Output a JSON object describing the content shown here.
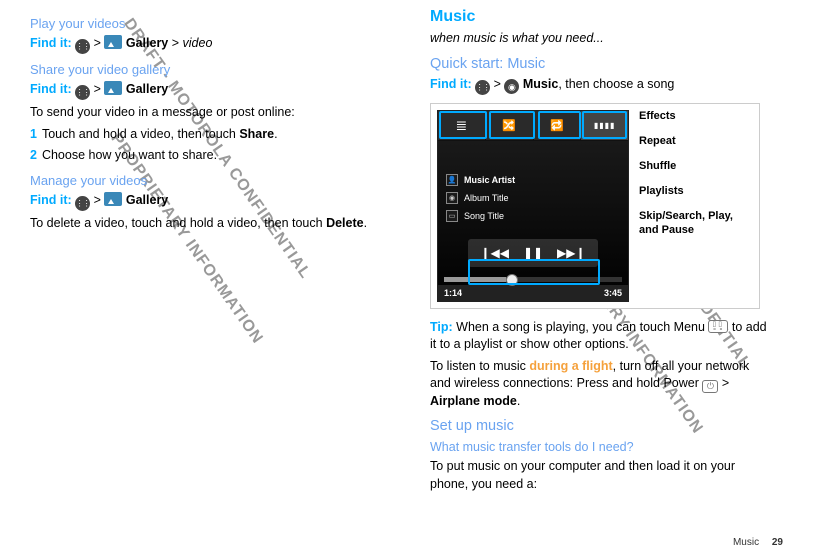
{
  "left": {
    "h_play": "Play your videos",
    "find1_label": "Find it:",
    "gallery": "Gallery",
    "video": "video",
    "h_share": "Share your video gallery",
    "find2_label": "Find it:",
    "share_intro": "To send your video in a message or post online:",
    "steps": {
      "s1_pre": "Touch and hold a video, then touch ",
      "s1_bold": "Share",
      "s1_post": ".",
      "s2": "Choose how you want to share."
    },
    "h_manage": "Manage your videos",
    "find3_label": "Find it:",
    "delete_pre": "To delete a video, touch and hold a video, then touch ",
    "delete_bold": "Delete",
    "delete_post": "."
  },
  "right": {
    "h_music": "Music",
    "subtitle": "when music is what you need...",
    "h_quick": "Quick start: Music",
    "find_label": "Find it:",
    "music": "Music",
    "find_post": ", then choose a song",
    "player": {
      "artist": "Music Artist",
      "album": "Album Title",
      "song": "Song Title",
      "t_elapsed": "1:14",
      "t_total": "3:45",
      "btn_prev": "❙◀◀",
      "btn_pause": "❚❚",
      "btn_next": "▶▶❙"
    },
    "callouts": {
      "effects": "Effects",
      "repeat": "Repeat",
      "shuffle": "Shuffle",
      "playlists": "Playlists",
      "skip": "Skip/Search, Play, and Pause"
    },
    "tip_label": "Tip:",
    "tip_text": " When a song is playing, you can touch Menu ",
    "tip_text2": " to add it to a playlist or show other options.",
    "flight_pre": "To listen to music ",
    "flight_link": "during a flight",
    "flight_mid": ", turn off all your network and wireless connections: Press and hold Power ",
    "airplane": "Airplane mode",
    "flight_post": ".",
    "h_setup": "Set up music",
    "h_tools": "What music transfer tools do I need?",
    "tools_text": "To put music on your computer and then load it on your phone, you need a:"
  },
  "watermarks": {
    "w1": "DRAFT - MOTOROLA CONFIDENTIAL",
    "w2": "PROPRIETARY INFORMATION",
    "w3": "DRAFT - MOTOROLA CONFIDENTIAL",
    "w4": "PROPRIETARY INFORMATION"
  },
  "footer": {
    "section": "Music",
    "page": "29"
  }
}
